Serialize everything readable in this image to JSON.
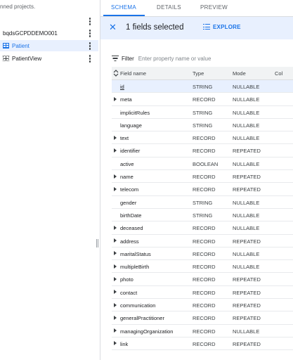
{
  "explorer": {
    "pinned_note": "nned projects.",
    "items": [
      {
        "label": "bqdsGCPDDEMO001",
        "kind": "dataset",
        "selected": false
      },
      {
        "label": "Patient",
        "kind": "table",
        "selected": true
      },
      {
        "label": "PatientView",
        "kind": "view",
        "selected": false
      }
    ]
  },
  "tabs": [
    {
      "label": "SCHEMA",
      "active": true
    },
    {
      "label": "DETAILS",
      "active": false
    },
    {
      "label": "PREVIEW",
      "active": false
    }
  ],
  "selection_bar": {
    "text": "1 fields selected",
    "explore_label": "EXPLORE"
  },
  "filter": {
    "label": "Filter",
    "placeholder": "Enter property name or value"
  },
  "table": {
    "columns": [
      "Field name",
      "Type",
      "Mode",
      "Col"
    ],
    "rows": [
      {
        "name": "id",
        "type": "STRING",
        "mode": "NULLABLE",
        "expandable": false,
        "selected": true
      },
      {
        "name": "meta",
        "type": "RECORD",
        "mode": "NULLABLE",
        "expandable": true,
        "selected": false
      },
      {
        "name": "implicitRules",
        "type": "STRING",
        "mode": "NULLABLE",
        "expandable": false,
        "selected": false
      },
      {
        "name": "language",
        "type": "STRING",
        "mode": "NULLABLE",
        "expandable": false,
        "selected": false
      },
      {
        "name": "text",
        "type": "RECORD",
        "mode": "NULLABLE",
        "expandable": true,
        "selected": false
      },
      {
        "name": "identifier",
        "type": "RECORD",
        "mode": "REPEATED",
        "expandable": true,
        "selected": false
      },
      {
        "name": "active",
        "type": "BOOLEAN",
        "mode": "NULLABLE",
        "expandable": false,
        "selected": false
      },
      {
        "name": "name",
        "type": "RECORD",
        "mode": "REPEATED",
        "expandable": true,
        "selected": false
      },
      {
        "name": "telecom",
        "type": "RECORD",
        "mode": "REPEATED",
        "expandable": true,
        "selected": false
      },
      {
        "name": "gender",
        "type": "STRING",
        "mode": "NULLABLE",
        "expandable": false,
        "selected": false
      },
      {
        "name": "birthDate",
        "type": "STRING",
        "mode": "NULLABLE",
        "expandable": false,
        "selected": false
      },
      {
        "name": "deceased",
        "type": "RECORD",
        "mode": "NULLABLE",
        "expandable": true,
        "selected": false
      },
      {
        "name": "address",
        "type": "RECORD",
        "mode": "REPEATED",
        "expandable": true,
        "selected": false
      },
      {
        "name": "maritalStatus",
        "type": "RECORD",
        "mode": "NULLABLE",
        "expandable": true,
        "selected": false
      },
      {
        "name": "multipleBirth",
        "type": "RECORD",
        "mode": "NULLABLE",
        "expandable": true,
        "selected": false
      },
      {
        "name": "photo",
        "type": "RECORD",
        "mode": "REPEATED",
        "expandable": true,
        "selected": false
      },
      {
        "name": "contact",
        "type": "RECORD",
        "mode": "REPEATED",
        "expandable": true,
        "selected": false
      },
      {
        "name": "communication",
        "type": "RECORD",
        "mode": "REPEATED",
        "expandable": true,
        "selected": false
      },
      {
        "name": "generalPractitioner",
        "type": "RECORD",
        "mode": "REPEATED",
        "expandable": true,
        "selected": false
      },
      {
        "name": "managingOrganization",
        "type": "RECORD",
        "mode": "NULLABLE",
        "expandable": true,
        "selected": false
      },
      {
        "name": "link",
        "type": "RECORD",
        "mode": "REPEATED",
        "expandable": true,
        "selected": false
      }
    ]
  },
  "colors": {
    "accent": "#1a73e8",
    "selected_bg": "#e8f0fe",
    "header_bg": "#f1f3f4"
  }
}
